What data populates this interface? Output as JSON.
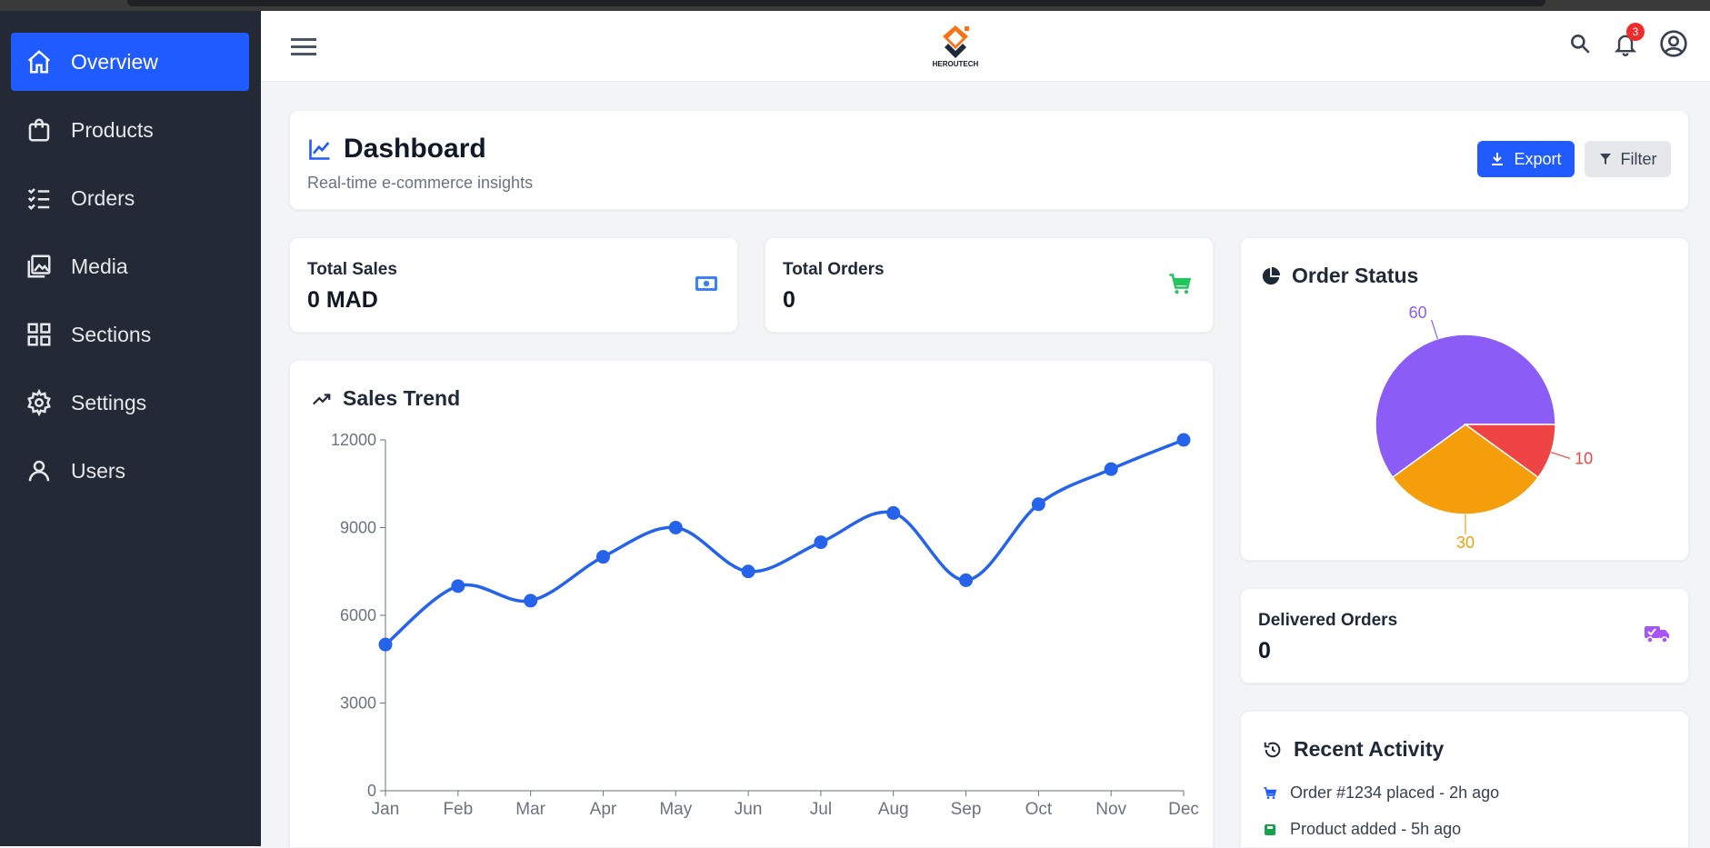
{
  "sidebar": {
    "items": [
      {
        "label": "Overview",
        "icon": "home-icon",
        "active": true
      },
      {
        "label": "Products",
        "icon": "shopping-bag-icon"
      },
      {
        "label": "Orders",
        "icon": "checklist-icon"
      },
      {
        "label": "Media",
        "icon": "images-icon"
      },
      {
        "label": "Sections",
        "icon": "grid-icon"
      },
      {
        "label": "Settings",
        "icon": "gear-icon"
      },
      {
        "label": "Users",
        "icon": "user-icon"
      }
    ]
  },
  "topbar": {
    "brand": "HEROUTECH",
    "notifications_count": "3"
  },
  "header": {
    "title": "Dashboard",
    "subtitle": "Real-time e-commerce insights",
    "export_label": "Export",
    "filter_label": "Filter"
  },
  "stats": {
    "total_sales": {
      "label": "Total Sales",
      "value": "0 MAD"
    },
    "total_orders": {
      "label": "Total Orders",
      "value": "0"
    },
    "delivered": {
      "label": "Delivered Orders",
      "value": "0"
    }
  },
  "sales_trend": {
    "title": "Sales Trend"
  },
  "order_status": {
    "title": "Order Status"
  },
  "recent_activity": {
    "title": "Recent Activity",
    "items": [
      "Order #1234 placed - 2h ago",
      "Product added - 5h ago"
    ]
  },
  "colors": {
    "accent": "#1f5bff",
    "sidebar_bg": "#232a36",
    "line": "#2563eb",
    "pie_purple": "#8b5cf6",
    "pie_orange": "#f59e0b",
    "pie_red": "#ef4444",
    "success": "#22c55e"
  },
  "chart_data": [
    {
      "type": "line",
      "title": "Sales Trend",
      "categories": [
        "Jan",
        "Feb",
        "Mar",
        "Apr",
        "May",
        "Jun",
        "Jul",
        "Aug",
        "Sep",
        "Oct",
        "Nov",
        "Dec"
      ],
      "values": [
        5000,
        7000,
        6500,
        8000,
        9000,
        7500,
        8500,
        9500,
        7200,
        9800,
        11000,
        12000
      ],
      "ylim": [
        0,
        12000
      ],
      "yticks": [
        0,
        3000,
        6000,
        9000,
        12000
      ],
      "grid": false
    },
    {
      "type": "pie",
      "title": "Order Status",
      "values": [
        60,
        30,
        10
      ],
      "labels": [
        "60",
        "30",
        "10"
      ],
      "colors": [
        "#8b5cf6",
        "#f59e0b",
        "#ef4444"
      ]
    }
  ]
}
